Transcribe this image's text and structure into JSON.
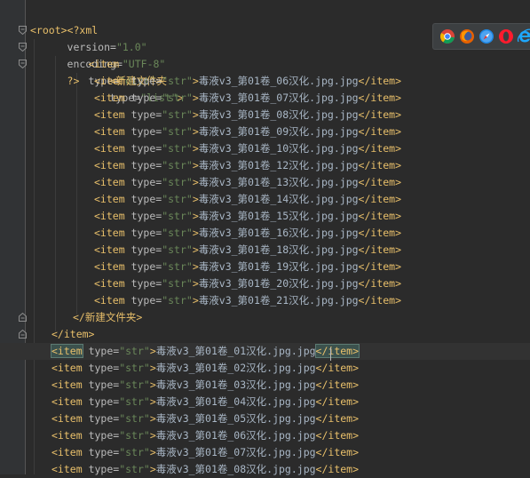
{
  "xml_declaration": {
    "open": "<?xml",
    "version_attr": "version",
    "version_value": "\"1.0\"",
    "encoding_attr": "encoding",
    "encoding_value": "\"UTF-8\"",
    "close": "?>"
  },
  "root_open": "<root>",
  "dict_item": {
    "open": "<item",
    "attr": "type",
    "value": "\"dict\"",
    "close": ">"
  },
  "folder": {
    "open": "<新建文件夹",
    "attr": "type",
    "value": "\"list\"",
    "close": ">",
    "end_tag": "</新建文件夹>"
  },
  "inner_items": [
    "毒液v3_第01卷_06汉化.jpg.jpg",
    "毒液v3_第01卷_07汉化.jpg.jpg",
    "毒液v3_第01卷_08汉化.jpg.jpg",
    "毒液v3_第01卷_09汉化.jpg.jpg",
    "毒液v3_第01卷_10汉化.jpg.jpg",
    "毒液v3_第01卷_12汉化.jpg.jpg",
    "毒液v3_第01卷_13汉化.jpg.jpg",
    "毒液v3_第01卷_14汉化.jpg.jpg",
    "毒液v3_第01卷_15汉化.jpg.jpg",
    "毒液v3_第01卷_16汉化.jpg.jpg",
    "毒液v3_第01卷_18汉化.jpg.jpg",
    "毒液v3_第01卷_19汉化.jpg.jpg",
    "毒液v3_第01卷_20汉化.jpg.jpg",
    "毒液v3_第01卷_21汉化.jpg.jpg"
  ],
  "item_end": "</item>",
  "outer_items": [
    "毒液v3_第01卷_01汉化.jpg.jpg",
    "毒液v3_第01卷_02汉化.jpg.jpg",
    "毒液v3_第01卷_03汉化.jpg.jpg",
    "毒液v3_第01卷_04汉化.jpg.jpg",
    "毒液v3_第01卷_05汉化.jpg.jpg",
    "毒液v3_第01卷_06汉化.jpg.jpg",
    "毒液v3_第01卷_07汉化.jpg.jpg",
    "毒液v3_第01卷_08汉化.jpg.jpg"
  ],
  "str_item": {
    "open": "<item",
    "attr": "type",
    "value": "\"str\"",
    "close": ">",
    "end": "</item>"
  },
  "browser_icons": [
    "chrome-icon",
    "firefox-icon",
    "safari-icon",
    "opera-icon",
    "ie-icon"
  ],
  "colors": {
    "background": "#2b2b2b",
    "tag": "#e8bf6a",
    "attribute_value": "#6a8759",
    "text": "#a9b7c6"
  }
}
